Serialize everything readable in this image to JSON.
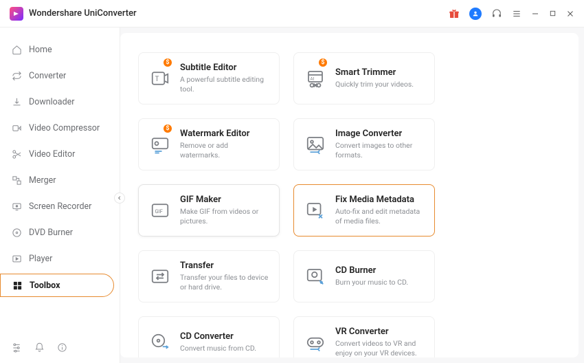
{
  "app": {
    "title": "Wondershare UniConverter"
  },
  "sidebar": {
    "items": [
      {
        "label": "Home"
      },
      {
        "label": "Converter"
      },
      {
        "label": "Downloader"
      },
      {
        "label": "Video Compressor"
      },
      {
        "label": "Video Editor"
      },
      {
        "label": "Merger"
      },
      {
        "label": "Screen Recorder"
      },
      {
        "label": "DVD Burner"
      },
      {
        "label": "Player"
      },
      {
        "label": "Toolbox"
      }
    ]
  },
  "tools": [
    {
      "title": "Subtitle Editor",
      "desc": "A powerful subtitle editing tool.",
      "badge": "$"
    },
    {
      "title": "Smart Trimmer",
      "desc": "Quickly trim your videos.",
      "badge": "$"
    },
    {
      "title": "Watermark Editor",
      "desc": "Remove or add watermarks.",
      "badge": "$"
    },
    {
      "title": "Image Converter",
      "desc": "Convert images to other formats."
    },
    {
      "title": "GIF Maker",
      "desc": "Make GIF from videos or pictures."
    },
    {
      "title": "Fix Media Metadata",
      "desc": "Auto-fix and edit metadata of media files."
    },
    {
      "title": "Transfer",
      "desc": "Transfer your files to device or hard drive."
    },
    {
      "title": "CD Burner",
      "desc": "Burn your music to CD."
    },
    {
      "title": "CD Converter",
      "desc": "Convert music from CD."
    },
    {
      "title": "VR Converter",
      "desc": "Convert videos to VR and enjoy on your VR devices."
    }
  ],
  "gif_label": "GIF",
  "ai_label": "AI"
}
